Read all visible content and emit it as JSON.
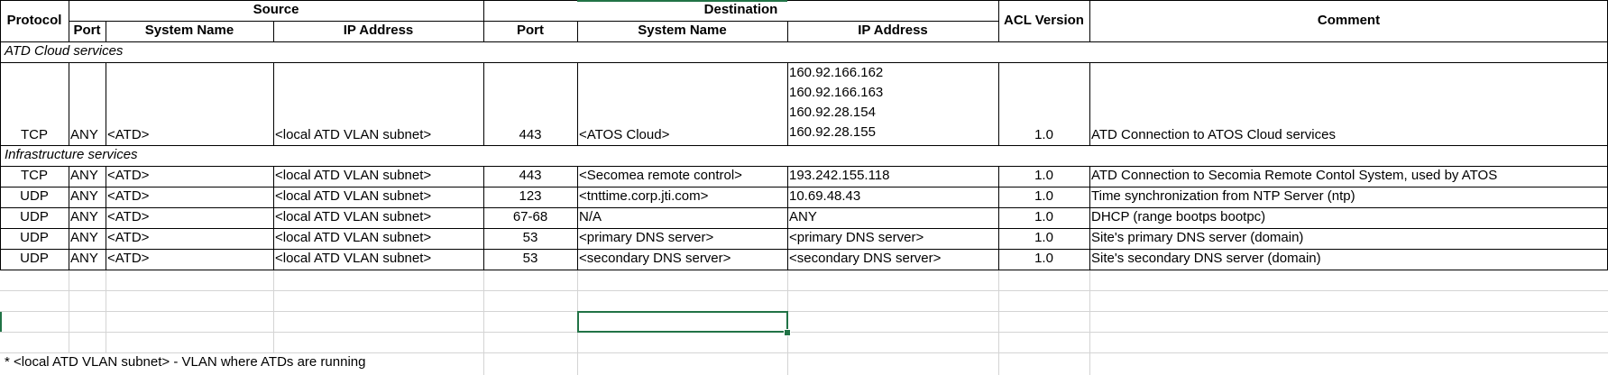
{
  "header": {
    "protocol": "Protocol",
    "source_group": "Source",
    "destination_group": "Destination",
    "acl_version": "ACL Version",
    "comment": "Comment",
    "src_port": "Port",
    "src_system_name": "System Name",
    "src_ip_address": "IP Address",
    "dst_port": "Port",
    "dst_system_name": "System Name",
    "dst_ip_address": "IP Address"
  },
  "sections": {
    "cloud": "ATD Cloud services",
    "infra": "Infrastructure services"
  },
  "cloud_row": {
    "protocol": "TCP",
    "src_port": "ANY",
    "src_system": "<ATD>",
    "src_ip": "<local ATD VLAN subnet>",
    "dst_port": "443",
    "dst_system": "<ATOS Cloud>",
    "dst_ips": [
      "160.92.166.162",
      "160.92.166.163",
      "160.92.28.154",
      "160.92.28.155"
    ],
    "acl": "1.0",
    "comment": "ATD Connection to ATOS Cloud services"
  },
  "infra_rows": [
    {
      "protocol": "TCP",
      "src_port": "ANY",
      "src_system": "<ATD>",
      "src_ip": "<local ATD VLAN subnet>",
      "dst_port": "443",
      "dst_system": "<Secomea remote control>",
      "dst_ip": "193.242.155.118",
      "acl": "1.0",
      "comment": "ATD Connection to Secomia Remote Contol System, used by ATOS"
    },
    {
      "protocol": "UDP",
      "src_port": "ANY",
      "src_system": "<ATD>",
      "src_ip": "<local ATD VLAN subnet>",
      "dst_port": "123",
      "dst_system": "<tnttime.corp.jti.com>",
      "dst_ip": "10.69.48.43",
      "acl": "1.0",
      "comment": "Time synchronization from NTP Server (ntp)"
    },
    {
      "protocol": "UDP",
      "src_port": "ANY",
      "src_system": "<ATD>",
      "src_ip": "<local ATD VLAN subnet>",
      "dst_port": "67-68",
      "dst_system": "N/A",
      "dst_ip": "ANY",
      "acl": "1.0",
      "comment": "DHCP (range bootps bootpc)"
    },
    {
      "protocol": "UDP",
      "src_port": "ANY",
      "src_system": "<ATD>",
      "src_ip": "<local ATD VLAN subnet>",
      "dst_port": "53",
      "dst_system": "<primary DNS server>",
      "dst_ip": "<primary DNS server>",
      "acl": "1.0",
      "comment": "Site's primary DNS server (domain)"
    },
    {
      "protocol": "UDP",
      "src_port": "ANY",
      "src_system": "<ATD>",
      "src_ip": "<local ATD VLAN subnet>",
      "dst_port": "53",
      "dst_system": "<secondary DNS server>",
      "dst_ip": "<secondary DNS server>",
      "acl": "1.0",
      "comment": "Site's secondary DNS server (domain)"
    }
  ],
  "footnote": "* <local ATD VLAN subnet> - VLAN where ATDs are running",
  "colors": {
    "selection": "#217346",
    "gridline": "#d4d4d4",
    "border": "#000000"
  }
}
